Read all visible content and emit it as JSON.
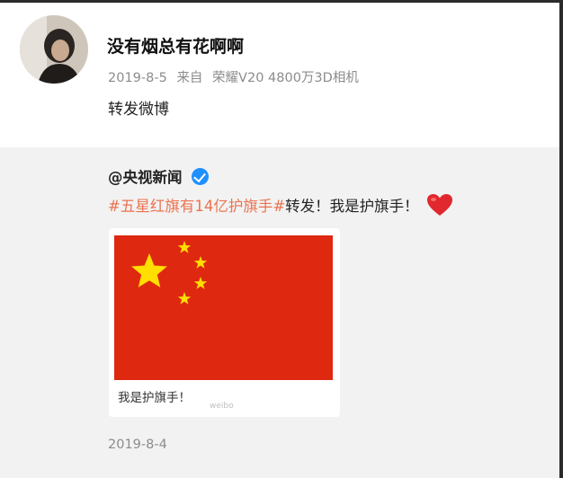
{
  "post": {
    "username": "没有烟总有花啊啊",
    "date": "2019-8-5",
    "source_prefix": "来自",
    "source_device": "荣耀V20 4800万3D相机",
    "text": "转发微博"
  },
  "repost": {
    "author": "@央视新闻",
    "hashtag": "#五星红旗有14亿护旗手#",
    "text": "转发！我是护旗手！",
    "card_caption": "我是护旗手！",
    "watermark": "weibo",
    "date": "2019-8-4"
  },
  "icons": {
    "verified": "verified-badge-icon",
    "heart": "heart-icon"
  },
  "colors": {
    "hashtag": "#eb7350",
    "verified": "#1e90ff",
    "flag_red": "#de2910",
    "flag_star": "#ffde00",
    "heart": "#e0282e"
  }
}
